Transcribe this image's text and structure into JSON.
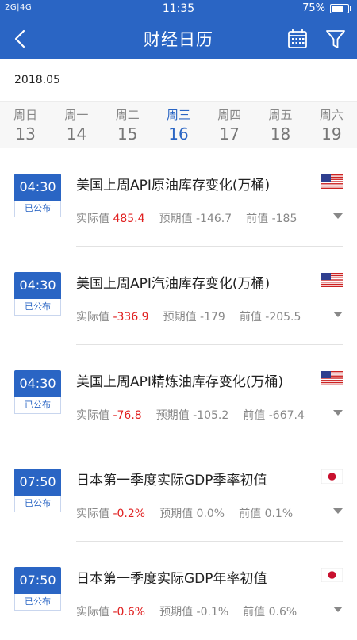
{
  "status_bar": {
    "signal": "2G|4G",
    "time": "11:35",
    "battery": "75%",
    "battery_level": 0.75
  },
  "header": {
    "title": "财经日历",
    "icons": [
      "back-arrow-icon",
      "calendar-icon",
      "filter-icon"
    ]
  },
  "month": "2018.05",
  "week": [
    {
      "weekday": "周日",
      "date": "13"
    },
    {
      "weekday": "周一",
      "date": "14"
    },
    {
      "weekday": "周二",
      "date": "15"
    },
    {
      "weekday": "周三",
      "date": "16",
      "active": true
    },
    {
      "weekday": "周四",
      "date": "17"
    },
    {
      "weekday": "周五",
      "date": "18"
    },
    {
      "weekday": "周六",
      "date": "19"
    }
  ],
  "colors": {
    "primary": "#2a65c4",
    "actual_value": "#e02020"
  },
  "events": [
    {
      "time": "04:30",
      "status": "已公布",
      "name": "美国上周API原油库存变化(万桶)",
      "flag": "us-flag-icon",
      "actual_label": "实际值",
      "actual": "485.4",
      "forecast_label": "预期值",
      "forecast": "-146.7",
      "previous_label": "前值",
      "previous": "-185"
    },
    {
      "time": "04:30",
      "status": "已公布",
      "name": "美国上周API汽油库存变化(万桶)",
      "flag": "us-flag-icon",
      "actual_label": "实际值",
      "actual": "-336.9",
      "forecast_label": "预期值",
      "forecast": "-179",
      "previous_label": "前值",
      "previous": "-205.5"
    },
    {
      "time": "04:30",
      "status": "已公布",
      "name": "美国上周API精炼油库存变化(万桶)",
      "flag": "us-flag-icon",
      "actual_label": "实际值",
      "actual": "-76.8",
      "forecast_label": "预期值",
      "forecast": "-105.2",
      "previous_label": "前值",
      "previous": "-667.4"
    },
    {
      "time": "07:50",
      "status": "已公布",
      "name": "日本第一季度实际GDP季率初值",
      "flag": "japan-flag-icon",
      "actual_label": "实际值",
      "actual": "-0.2%",
      "forecast_label": "预期值",
      "forecast": "0.0%",
      "previous_label": "前值",
      "previous": "0.1%"
    },
    {
      "time": "07:50",
      "status": "已公布",
      "name": "日本第一季度实际GDP年率初值",
      "flag": "japan-flag-icon",
      "actual_label": "实际值",
      "actual": "-0.6%",
      "forecast_label": "预期值",
      "forecast": "-0.1%",
      "previous_label": "前值",
      "previous": "0.6%"
    }
  ]
}
